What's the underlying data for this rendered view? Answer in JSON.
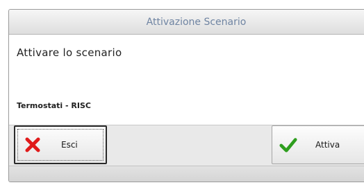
{
  "dialog": {
    "title": "Attivazione Scenario",
    "message": "Attivare lo scenario",
    "scenario_name": "Termostati - RISC"
  },
  "buttons": {
    "exit": {
      "label": "Esci",
      "icon": "close-x-icon",
      "color": "#e01b1b"
    },
    "activate": {
      "label": "Attiva",
      "icon": "checkmark-icon",
      "color": "#2e9e1e"
    }
  }
}
